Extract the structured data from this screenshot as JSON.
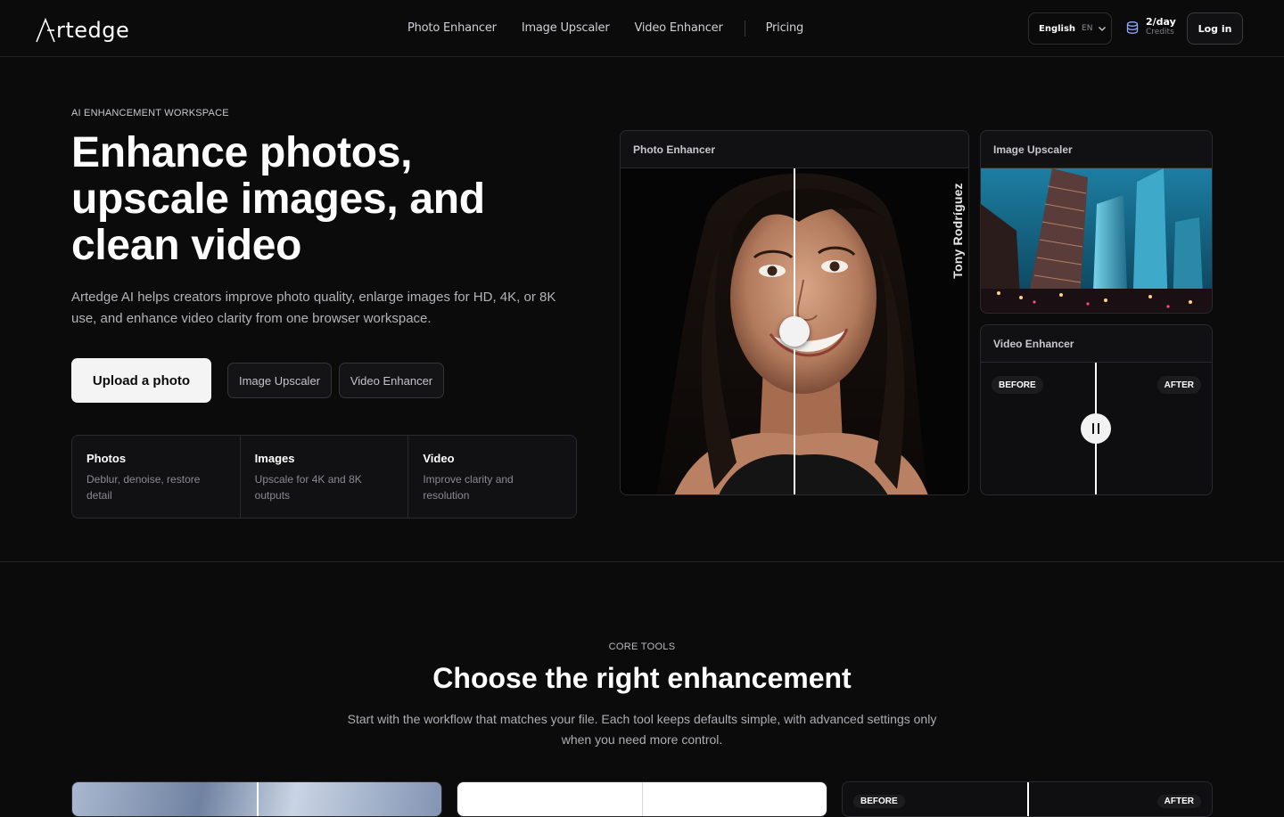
{
  "header": {
    "logo_text": "rtedge",
    "nav": [
      "Photo Enhancer",
      "Image Upscaler",
      "Video Enhancer",
      "Pricing"
    ],
    "language": {
      "label": "English",
      "code": "EN"
    },
    "credits": {
      "amount": "2/day",
      "label": "Credits"
    },
    "login_label": "Log in"
  },
  "hero": {
    "eyebrow": "AI ENHANCEMENT WORKSPACE",
    "title": "Enhance photos, upscale images, and clean video",
    "description": "Artedge AI helps creators improve photo quality, enlarge images for HD, 4K, or 8K use, and enhance video clarity from one browser workspace.",
    "primary_button": "Upload a photo",
    "secondary_buttons": [
      "Image Upscaler",
      "Video Enhancer"
    ],
    "features": [
      {
        "title": "Photos",
        "desc": "Deblur, denoise, restore detail"
      },
      {
        "title": "Images",
        "desc": "Upscale for 4K and 8K outputs"
      },
      {
        "title": "Video",
        "desc": "Improve clarity and resolution"
      }
    ]
  },
  "previews": {
    "photo": {
      "title": "Photo Enhancer",
      "signature": "Tony Rodríguez"
    },
    "upscale": {
      "title": "Image Upscaler"
    },
    "video": {
      "title": "Video Enhancer",
      "before": "BEFORE",
      "after": "AFTER"
    }
  },
  "core": {
    "eyebrow": "CORE TOOLS",
    "title": "Choose the right enhancement",
    "description": "Start with the workflow that matches your file. Each tool keeps defaults simple, with advanced settings only when you need more control.",
    "card3_before": "BEFORE",
    "card3_after": "AFTER"
  },
  "colors": {
    "background": "#0b0b0c",
    "accent": "#8fa6ff",
    "button_light": "#f4f4f5"
  },
  "icons": [
    "logo-a-icon",
    "chevron-down-icon",
    "coins-icon",
    "pause-icon"
  ]
}
